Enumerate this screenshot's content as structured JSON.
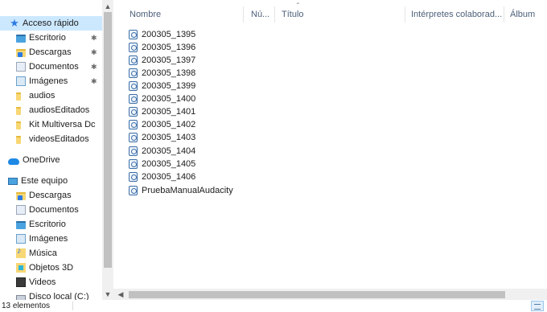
{
  "nav": {
    "quick_access": {
      "label": "Acceso rápido",
      "icon": "star-icon"
    },
    "pinned": [
      {
        "label": "Escritorio",
        "icon": "desktop-folder-icon",
        "pinned": true
      },
      {
        "label": "Descargas",
        "icon": "downloads-folder-icon",
        "pinned": true
      },
      {
        "label": "Documentos",
        "icon": "documents-folder-icon",
        "pinned": true
      },
      {
        "label": "Imágenes",
        "icon": "pictures-folder-icon",
        "pinned": true
      },
      {
        "label": "audios",
        "icon": "folder-icon",
        "pinned": false
      },
      {
        "label": "audiosEditados",
        "icon": "folder-icon",
        "pinned": false
      },
      {
        "label": "Kit Multiversa Dc",
        "icon": "folder-icon",
        "pinned": false
      },
      {
        "label": "videosEditados",
        "icon": "folder-icon",
        "pinned": false
      }
    ],
    "onedrive": {
      "label": "OneDrive",
      "icon": "onedrive-cloud-icon"
    },
    "this_pc": {
      "label": "Este equipo",
      "icon": "computer-icon"
    },
    "pc_items": [
      {
        "label": "Descargas",
        "icon": "downloads-folder-icon"
      },
      {
        "label": "Documentos",
        "icon": "documents-folder-icon"
      },
      {
        "label": "Escritorio",
        "icon": "desktop-folder-icon"
      },
      {
        "label": "Imágenes",
        "icon": "pictures-folder-icon"
      },
      {
        "label": "Música",
        "icon": "music-folder-icon"
      },
      {
        "label": "Objetos 3D",
        "icon": "objects-3d-folder-icon"
      },
      {
        "label": "Videos",
        "icon": "videos-folder-icon"
      },
      {
        "label": "Disco local (C:)",
        "icon": "local-disk-icon"
      }
    ],
    "pin_glyph": "📌"
  },
  "columns": [
    "Nombre",
    "Nú...",
    "Título",
    "Intérpretes colaborad...",
    "Álbum"
  ],
  "files": [
    "200305_1395",
    "200305_1396",
    "200305_1397",
    "200305_1398",
    "200305_1399",
    "200305_1400",
    "200305_1401",
    "200305_1402",
    "200305_1403",
    "200305_1404",
    "200305_1405",
    "200305_1406",
    "PruebaManualAudacity"
  ],
  "status": {
    "item_count": "13 elementos"
  },
  "colors": {
    "selected_bg": "#cce8ff",
    "header_text": "#4c607a",
    "accent": "#2c7be5"
  }
}
